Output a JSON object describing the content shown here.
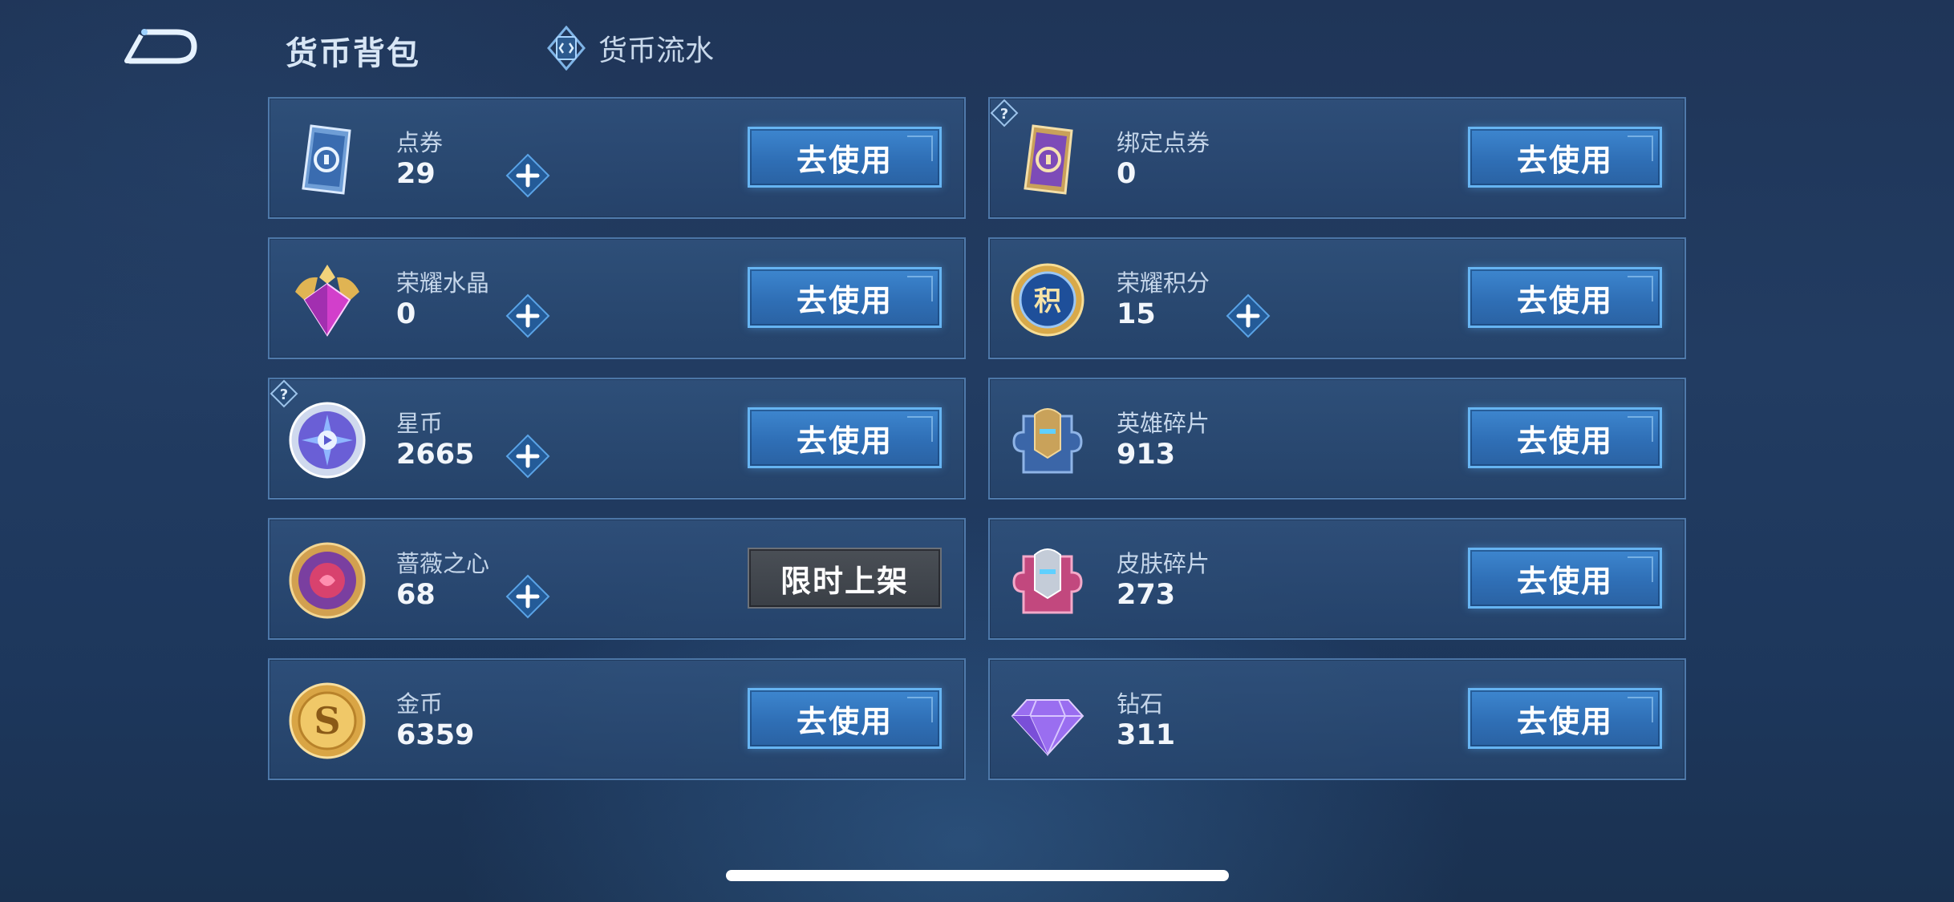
{
  "header": {
    "title": "货币背包",
    "flow_tab_label": "货币流水"
  },
  "currencies": [
    {
      "name": "点券",
      "amount": "29",
      "button": "去使用"
    },
    {
      "name": "绑定点券",
      "amount": "0",
      "button": "去使用"
    },
    {
      "name": "荣耀水晶",
      "amount": "0",
      "button": "去使用"
    },
    {
      "name": "荣耀积分",
      "amount": "15",
      "button": "去使用"
    },
    {
      "name": "星币",
      "amount": "2665",
      "button": "去使用"
    },
    {
      "name": "英雄碎片",
      "amount": "913",
      "button": "去使用"
    },
    {
      "name": "蔷薇之心",
      "amount": "68",
      "button": "限时上架"
    },
    {
      "name": "皮肤碎片",
      "amount": "273",
      "button": "去使用"
    },
    {
      "name": "金币",
      "amount": "6359",
      "button": "去使用"
    },
    {
      "name": "钻石",
      "amount": "311",
      "button": "去使用"
    }
  ],
  "icons": {
    "back": "back-arrow-icon",
    "flow": "currency-flow-icon",
    "plus": "plus-icon",
    "help": "help-icon"
  },
  "colors": {
    "accent": "#3d86cf",
    "button_border": "#66b4f2",
    "disabled_button": "#3f444b",
    "background": "#213a5f"
  }
}
